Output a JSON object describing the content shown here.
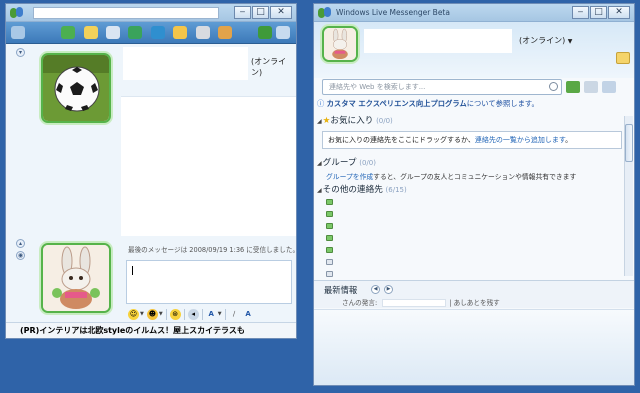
{
  "colors": {
    "desktop": "#2f63a8",
    "toolbar": "#4d8bc8",
    "link": "#2064b6",
    "online_green": "#56b34a"
  },
  "chat_window": {
    "toolbar_label": "",
    "status": "(オンライン)",
    "history_note": "最後のメッセージは 2008/09/19 1:36 に受信しました。",
    "ad_text": "(PR)インテリアは北欧styleのイルムス！屋上スカイテラスも",
    "icons": [
      "invite-icon",
      "share-files-icon",
      "video-call-icon",
      "call-icon",
      "activities-icon",
      "games-icon",
      "block-icon",
      "display-picture-icon",
      "draw-icon",
      "menu-icon"
    ],
    "format_icons": [
      "emoticon-icon",
      "wink-icon",
      "nudge-icon",
      "voice-clip-icon",
      "font-icon",
      "handwriting-icon",
      "text-icon"
    ]
  },
  "messenger_window": {
    "title": "Windows Live Messenger Beta",
    "status": "(オンライン)",
    "search_placeholder": "連絡先や Web を検索します...",
    "notice_bold": "カスタマ エクスペリエンス向上プログラム",
    "notice_rest": "について参照します。",
    "favorites": {
      "label": "お気に入り",
      "count": "(0/0)",
      "hint_start": "お気に入りの連絡先をここにドラッグするか、",
      "hint_link": "連絡先の一覧から追加します",
      "hint_end": "。"
    },
    "groups": {
      "label": "グループ",
      "count": "(0/0)",
      "hint_link": "グループを作成",
      "hint_rest": "すると、グループの友人とコミュニケーションや情報共有できます"
    },
    "others": {
      "label": "その他の連絡先",
      "count": "(6/15)",
      "contacts": [
        "online",
        "online",
        "online",
        "online",
        "online",
        "offline",
        "offline"
      ]
    },
    "news": {
      "label": "最新情報",
      "prefix": "さんの発言: ",
      "suffix": "| あしあとを残す"
    }
  }
}
